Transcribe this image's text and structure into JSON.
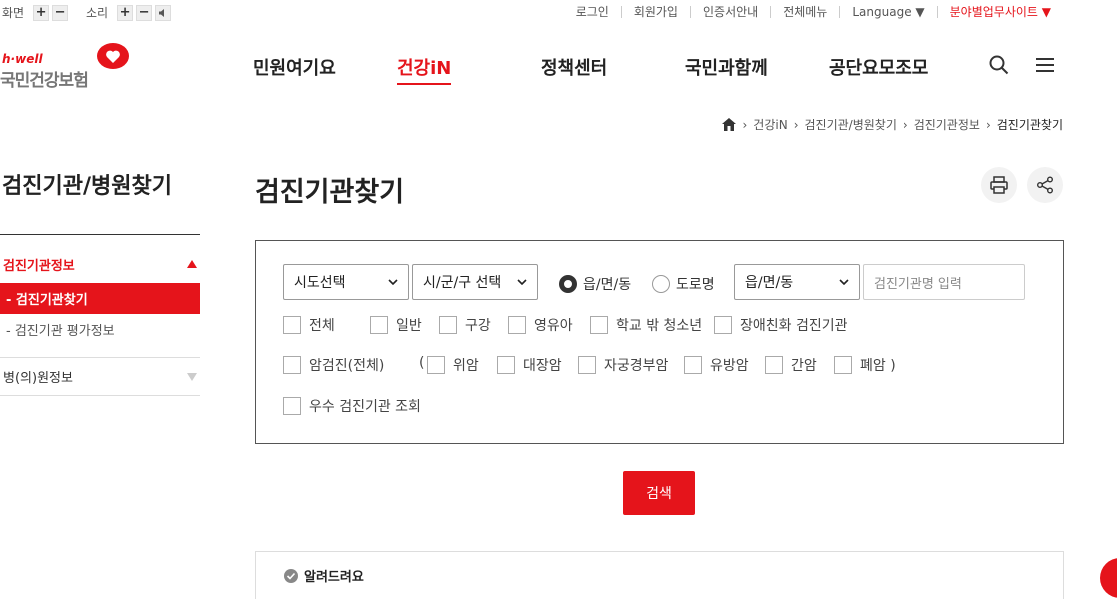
{
  "util": {
    "screen_label": "화면",
    "sound_label": "소리",
    "plus": "+",
    "minus": "−",
    "links": [
      "로그인",
      "회원가입",
      "인증서안내",
      "전체메뉴",
      "Language ▼"
    ],
    "field_site": "분야별업무사이트 ▼"
  },
  "logo": {
    "brand_en": "h·well",
    "brand_ko": "국민건강보험"
  },
  "gnb": [
    "민원여기요",
    "건강iN",
    "정책센터",
    "국민과함께",
    "공단요모조모"
  ],
  "breadcrumb": [
    "건강iN",
    "검진기관/병원찾기",
    "검진기관정보",
    "검진기관찾기"
  ],
  "sidebar": {
    "title": "검진기관/병원찾기",
    "group1": "검진기관정보",
    "items": [
      "- 검진기관찾기",
      "- 검진기관 평가정보"
    ],
    "group2": "병(의)원정보"
  },
  "page_title": "검진기관찾기",
  "form": {
    "sido": "시도선택",
    "sigungu": "시/군/구 선택",
    "radio1": "읍/면/동",
    "radio2": "도로명",
    "dong": "읍/면/동",
    "name_placeholder": "검진기관명 입력",
    "row1": [
      "전체",
      "일반",
      "구강",
      "영유아",
      "학교 밖 청소년",
      "장애친화 검진기관"
    ],
    "cancer_all": "암검진(전체)",
    "paren_open": "(",
    "row2": [
      "위암",
      "대장암",
      "자궁경부암",
      "유방암",
      "간암",
      "폐암 )"
    ],
    "excellent": "우수 검진기관 조회"
  },
  "search_button": "검색",
  "notice": "알려드려요",
  "colors": {
    "accent": "#e5141b"
  }
}
